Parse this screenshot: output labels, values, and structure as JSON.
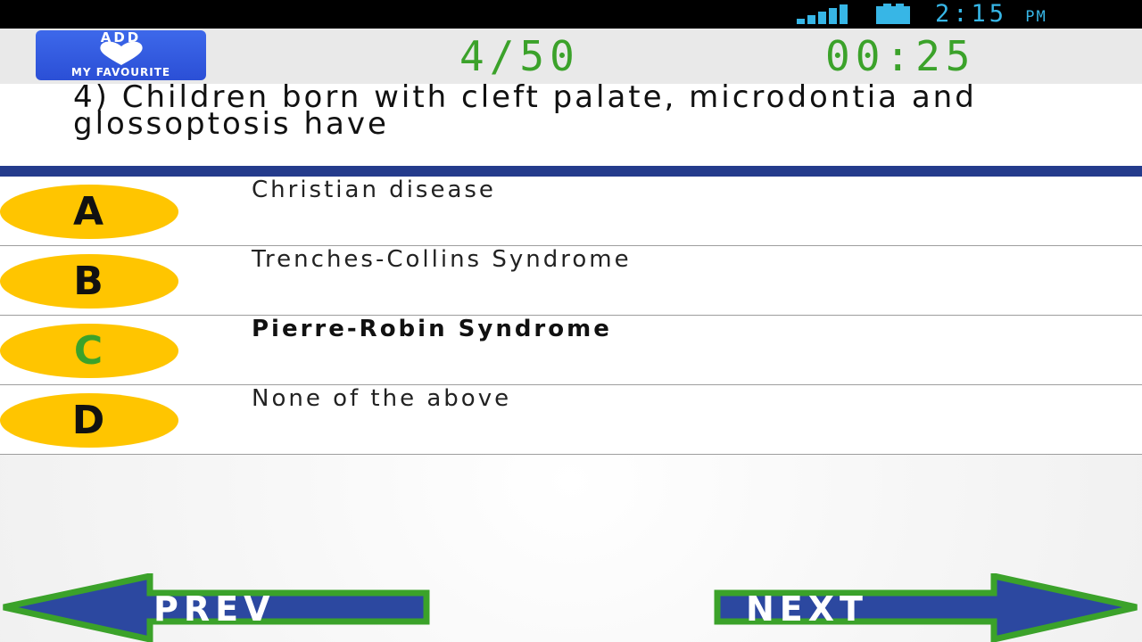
{
  "status_bar": {
    "time": "2:15",
    "ampm": "PM",
    "icons": [
      "signal-icon",
      "battery-icon"
    ],
    "clock_color": "#37b6e6"
  },
  "header": {
    "favourite_button": {
      "top_label": "ADD",
      "bottom_label": "MY FAVOURITE",
      "icon": "heart-icon"
    },
    "progress": "4/50",
    "timer": "00:25",
    "accent_color": "#3ba22a"
  },
  "question": {
    "text": "4) Children born with cleft palate, microdontia and glossoptosis have"
  },
  "options": [
    {
      "letter": "A",
      "text": "Christian disease"
    },
    {
      "letter": "B",
      "text": "Trenches-Collins Syndrome"
    },
    {
      "letter": "C",
      "text": "Pierre-Robin Syndrome"
    },
    {
      "letter": "D",
      "text": "None of the above"
    }
  ],
  "navigation": {
    "prev_label": "PREV",
    "next_label": "NEXT"
  },
  "colors": {
    "badge": "#ffc500",
    "divider": "#243b8c",
    "arrow_fill": "#2c48a0",
    "arrow_border": "#3ba22a"
  }
}
